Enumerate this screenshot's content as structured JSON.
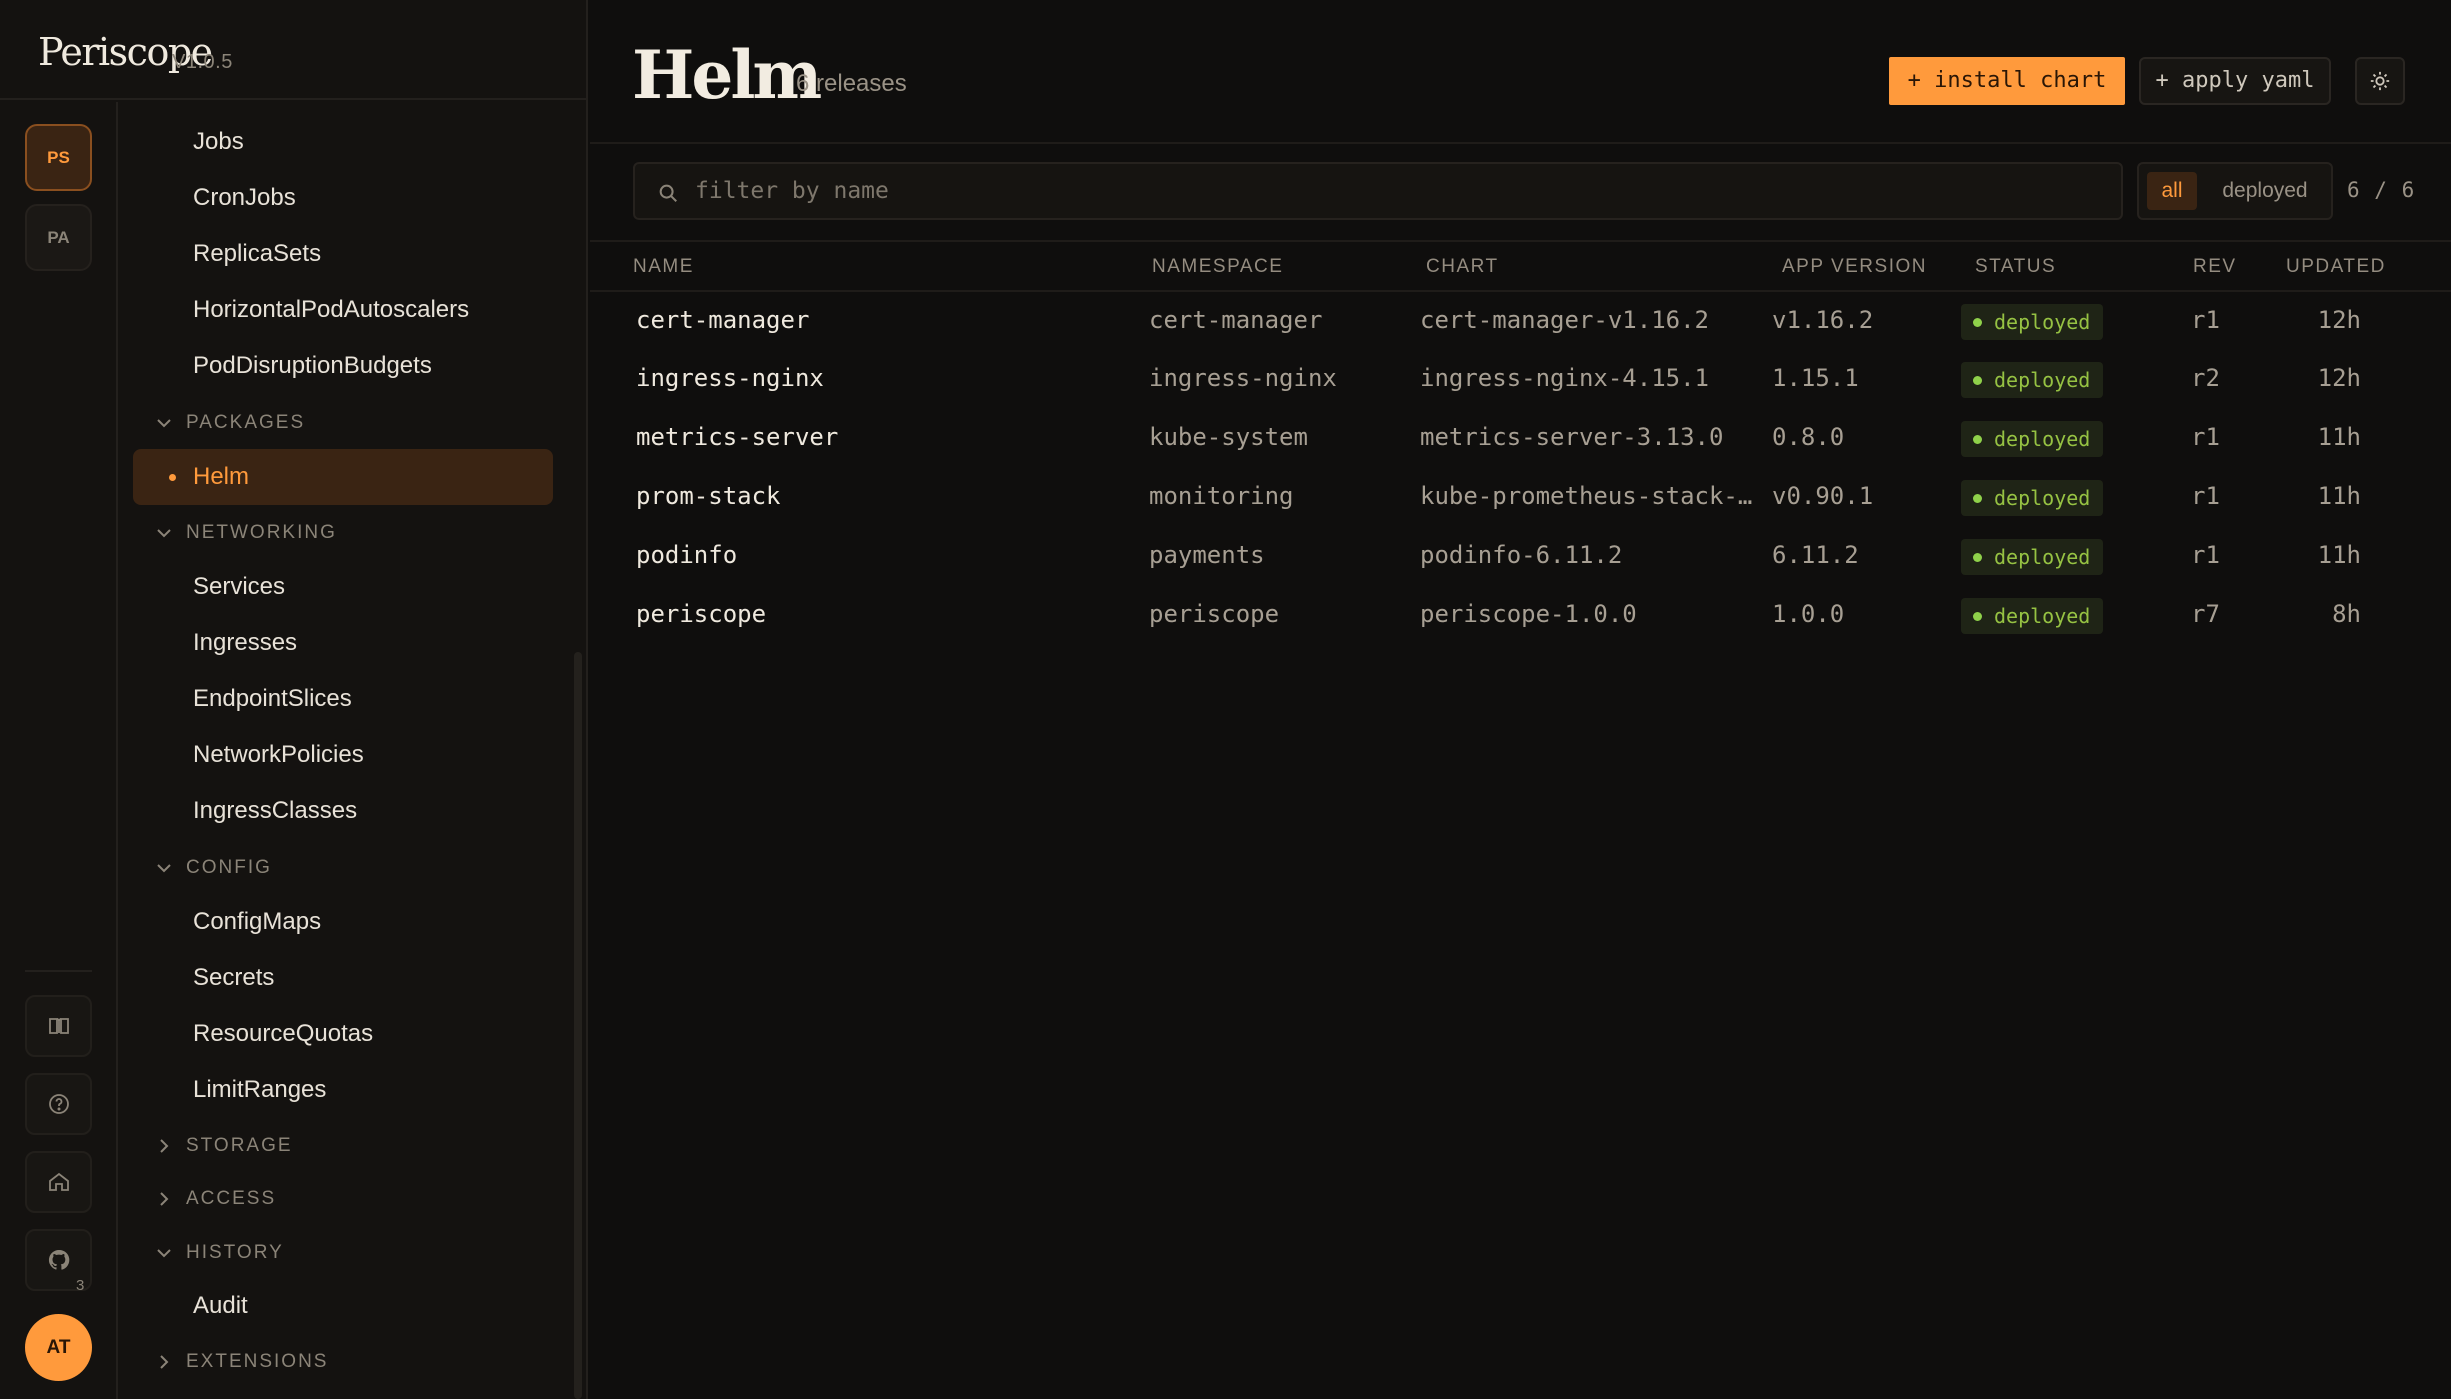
{
  "brand": {
    "name": "Periscope",
    "version": "V1.0.5"
  },
  "contexts": [
    "PS",
    "PA"
  ],
  "rail": {
    "github_count": "3",
    "avatar": "AT"
  },
  "nav": {
    "items_top": [
      "Jobs",
      "CronJobs",
      "ReplicaSets",
      "HorizontalPodAutoscalers",
      "PodDisruptionBudgets"
    ],
    "packages": {
      "label": "PACKAGES",
      "items": [
        "Helm"
      ]
    },
    "networking": {
      "label": "NETWORKING",
      "items": [
        "Services",
        "Ingresses",
        "EndpointSlices",
        "NetworkPolicies",
        "IngressClasses"
      ]
    },
    "config": {
      "label": "CONFIG",
      "items": [
        "ConfigMaps",
        "Secrets",
        "ResourceQuotas",
        "LimitRanges"
      ]
    },
    "storage": {
      "label": "STORAGE"
    },
    "access": {
      "label": "ACCESS"
    },
    "history": {
      "label": "HISTORY",
      "items": [
        "Audit"
      ]
    },
    "extensions": {
      "label": "EXTENSIONS"
    }
  },
  "header": {
    "title": "Helm",
    "subtitle": "6 releases",
    "install_label": "+ install chart",
    "apply_label": "+ apply yaml"
  },
  "filter": {
    "placeholder": "filter by name",
    "options": [
      "all",
      "deployed"
    ],
    "count": "6 / 6"
  },
  "table": {
    "columns": [
      "NAME",
      "NAMESPACE",
      "CHART",
      "APP VERSION",
      "STATUS",
      "REV",
      "UPDATED"
    ],
    "rows": [
      {
        "name": "cert-manager",
        "namespace": "cert-manager",
        "chart": "cert-manager-v1.16.2",
        "app_version": "v1.16.2",
        "status": "deployed",
        "rev": "r1",
        "updated": "12h"
      },
      {
        "name": "ingress-nginx",
        "namespace": "ingress-nginx",
        "chart": "ingress-nginx-4.15.1",
        "app_version": "1.15.1",
        "status": "deployed",
        "rev": "r2",
        "updated": "12h"
      },
      {
        "name": "metrics-server",
        "namespace": "kube-system",
        "chart": "metrics-server-3.13.0",
        "app_version": "0.8.0",
        "status": "deployed",
        "rev": "r1",
        "updated": "11h"
      },
      {
        "name": "prom-stack",
        "namespace": "monitoring",
        "chart": "kube-prometheus-stack-…",
        "app_version": "v0.90.1",
        "status": "deployed",
        "rev": "r1",
        "updated": "11h"
      },
      {
        "name": "podinfo",
        "namespace": "payments",
        "chart": "podinfo-6.11.2",
        "app_version": "6.11.2",
        "status": "deployed",
        "rev": "r1",
        "updated": "11h"
      },
      {
        "name": "periscope",
        "namespace": "periscope",
        "chart": "periscope-1.0.0",
        "app_version": "1.0.0",
        "status": "deployed",
        "rev": "r7",
        "updated": "8h"
      }
    ]
  },
  "colors": {
    "accent": "#ff9a3c",
    "background": "#0f0e0d",
    "status_ok": "#8fd14a"
  }
}
